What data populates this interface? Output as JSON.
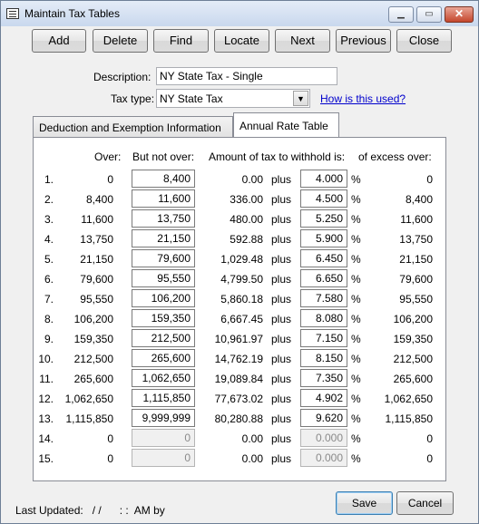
{
  "window": {
    "title": "Maintain Tax Tables"
  },
  "toolbar": {
    "add": "Add",
    "delete": "Delete",
    "find": "Find",
    "locate": "Locate",
    "next": "Next",
    "previous": "Previous",
    "close": "Close"
  },
  "form": {
    "description_label": "Description:",
    "description_value": "NY State Tax - Single",
    "taxtype_label": "Tax type:",
    "taxtype_value": "NY State Tax",
    "help_link": "How is this used?"
  },
  "tabs": [
    {
      "label": "Deduction and Exemption Information"
    },
    {
      "label": "Annual Rate Table"
    }
  ],
  "table": {
    "headers": {
      "over": "Over:",
      "not_over": "But not over:",
      "amount": "Amount of tax to withhold is:",
      "excess": "of excess over:"
    },
    "plus": "plus",
    "pct": "%",
    "rows": [
      {
        "n": "1.",
        "over": "0",
        "not_over": "8,400",
        "amount": "0.00",
        "rate": "4.000",
        "excess": "0"
      },
      {
        "n": "2.",
        "over": "8,400",
        "not_over": "11,600",
        "amount": "336.00",
        "rate": "4.500",
        "excess": "8,400"
      },
      {
        "n": "3.",
        "over": "11,600",
        "not_over": "13,750",
        "amount": "480.00",
        "rate": "5.250",
        "excess": "11,600"
      },
      {
        "n": "4.",
        "over": "13,750",
        "not_over": "21,150",
        "amount": "592.88",
        "rate": "5.900",
        "excess": "13,750"
      },
      {
        "n": "5.",
        "over": "21,150",
        "not_over": "79,600",
        "amount": "1,029.48",
        "rate": "6.450",
        "excess": "21,150"
      },
      {
        "n": "6.",
        "over": "79,600",
        "not_over": "95,550",
        "amount": "4,799.50",
        "rate": "6.650",
        "excess": "79,600"
      },
      {
        "n": "7.",
        "over": "95,550",
        "not_over": "106,200",
        "amount": "5,860.18",
        "rate": "7.580",
        "excess": "95,550"
      },
      {
        "n": "8.",
        "over": "106,200",
        "not_over": "159,350",
        "amount": "6,667.45",
        "rate": "8.080",
        "excess": "106,200"
      },
      {
        "n": "9.",
        "over": "159,350",
        "not_over": "212,500",
        "amount": "10,961.97",
        "rate": "7.150",
        "excess": "159,350"
      },
      {
        "n": "10.",
        "over": "212,500",
        "not_over": "265,600",
        "amount": "14,762.19",
        "rate": "8.150",
        "excess": "212,500"
      },
      {
        "n": "11.",
        "over": "265,600",
        "not_over": "1,062,650",
        "amount": "19,089.84",
        "rate": "7.350",
        "excess": "265,600"
      },
      {
        "n": "12.",
        "over": "1,062,650",
        "not_over": "1,115,850",
        "amount": "77,673.02",
        "rate": "4.902",
        "excess": "1,062,650"
      },
      {
        "n": "13.",
        "over": "1,115,850",
        "not_over": "9,999,999",
        "amount": "80,280.88",
        "rate": "9.620",
        "excess": "1,115,850"
      },
      {
        "n": "14.",
        "over": "0",
        "not_over": "0",
        "amount": "0.00",
        "rate": "0.000",
        "excess": "0",
        "disabled": true
      },
      {
        "n": "15.",
        "over": "0",
        "not_over": "0",
        "amount": "0.00",
        "rate": "0.000",
        "excess": "0",
        "disabled": true
      }
    ]
  },
  "footer": {
    "last_updated": "Last Updated:   / /      : :  AM by",
    "save": "Save",
    "cancel": "Cancel"
  }
}
